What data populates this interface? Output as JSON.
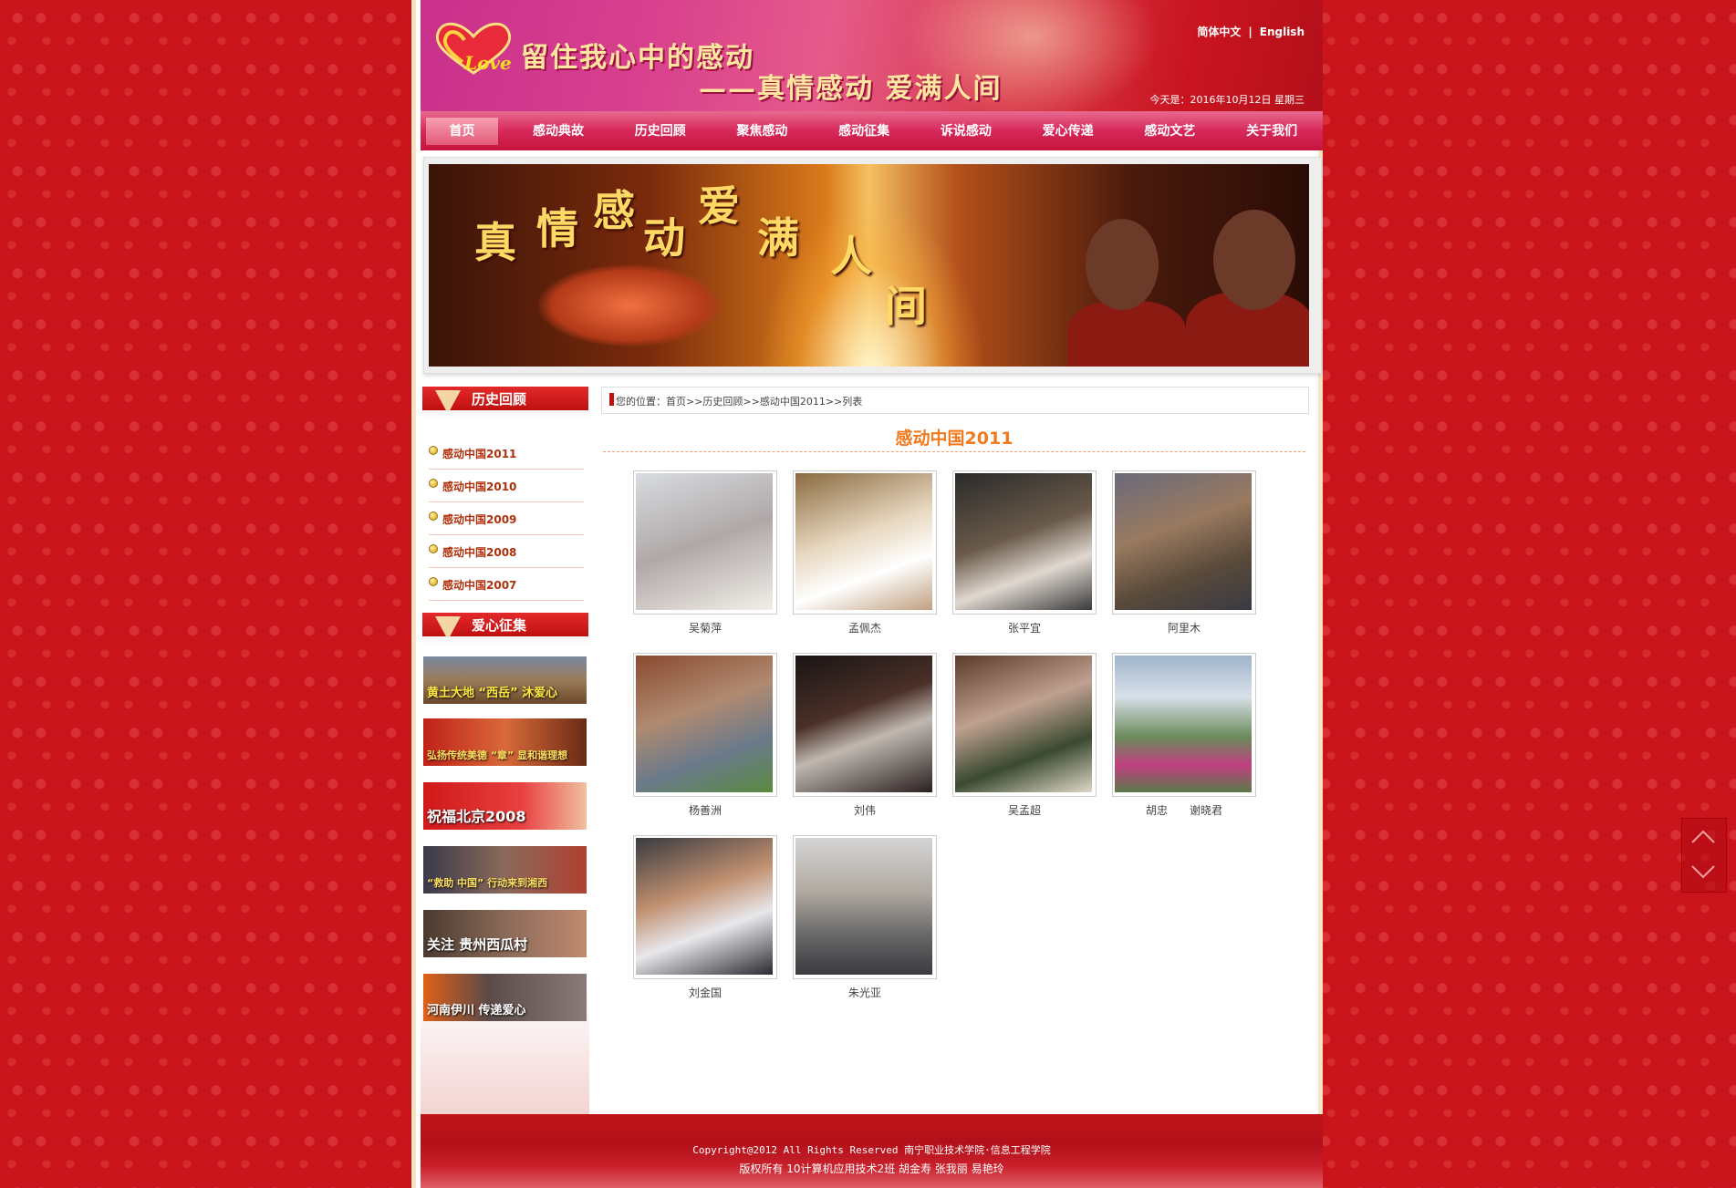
{
  "header": {
    "slogan_line1": "留住我心中的感动",
    "slogan_line2": "——真情感动   爱满人间",
    "logo_text": "Love",
    "lang_zh": "简体中文",
    "lang_sep": "|",
    "lang_en": "English",
    "today": "今天是：2016年10月12日  星期三"
  },
  "nav": {
    "items": [
      {
        "label": "首页"
      },
      {
        "label": "感动典故"
      },
      {
        "label": "历史回顾"
      },
      {
        "label": "聚焦感动"
      },
      {
        "label": "感动征集"
      },
      {
        "label": "诉说感动"
      },
      {
        "label": "爱心传递"
      },
      {
        "label": "感动文艺"
      },
      {
        "label": "关于我们"
      }
    ]
  },
  "banner": {
    "chars": [
      "真",
      "情",
      "感",
      "动",
      "爱",
      "满",
      "人",
      "间"
    ]
  },
  "sidebar": {
    "history_title": "历史回顾",
    "history_items": [
      {
        "label": "感动中国2011"
      },
      {
        "label": "感动中国2010"
      },
      {
        "label": "感动中国2009"
      },
      {
        "label": "感动中国2008"
      },
      {
        "label": "感动中国2007"
      }
    ],
    "collect_title": "爱心征集",
    "ads": [
      {
        "caption": "黄土大地 “西岳” 沐爱心"
      },
      {
        "caption": "弘扬传统美德 “章” 显和谐理想"
      },
      {
        "caption": "祝福北京2008"
      },
      {
        "caption": "“救助 中国” 行动来到湘西"
      },
      {
        "caption": "关注 贵州西瓜村"
      },
      {
        "caption": "河南伊川 传递爱心"
      }
    ]
  },
  "breadcrumb": {
    "text": "您的位置：首页>>历史回顾>>感动中国2011>>列表"
  },
  "main": {
    "title": "感动中国2011",
    "people": [
      {
        "name": "吴菊萍"
      },
      {
        "name": "孟佩杰"
      },
      {
        "name": "张平宜"
      },
      {
        "name": "阿里木"
      },
      {
        "name": "杨善洲"
      },
      {
        "name": "刘伟"
      },
      {
        "name": "吴孟超"
      },
      {
        "name": "胡忠　　谢晓君"
      },
      {
        "name": "刘金国"
      },
      {
        "name": "朱光亚"
      }
    ]
  },
  "footer": {
    "line1": "Copyright@2012 All Rights Reserved 南宁职业技术学院·信息工程学院",
    "line2": "版权所有 10计算机应用技术2班 胡金寿 张我丽 易艳玲"
  },
  "colors": {
    "brand_red": "#c01010",
    "title_orange": "#f07a1e",
    "link_brown": "#b0300c"
  }
}
